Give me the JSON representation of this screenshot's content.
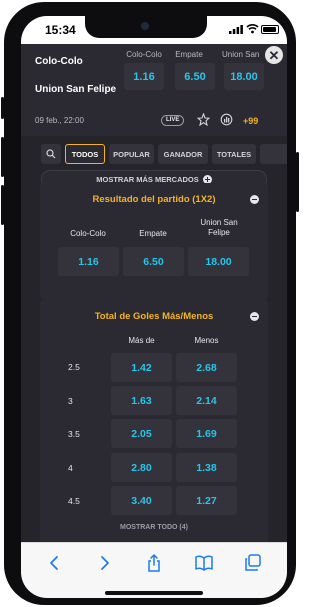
{
  "status": {
    "time": "15:34"
  },
  "match": {
    "home": "Colo-Colo",
    "away": "Union San Felipe",
    "date": "09 feb., 22:00",
    "live_label": "LIVE",
    "more_markets_count": "+99",
    "odds": [
      {
        "label": "Colo-Colo",
        "value": "1.16"
      },
      {
        "label": "Empate",
        "value": "6.50"
      },
      {
        "label": "Union San Felipe",
        "value": "18.00"
      }
    ],
    "close_symbol": "✕"
  },
  "filters": {
    "chips": [
      "TODOS",
      "POPULAR",
      "GANADOR",
      "TOTALES"
    ],
    "active": "TODOS"
  },
  "show_more_markets": "MOSTRAR MÁS MERCADOS",
  "result_market": {
    "title": "Resultado del partido (1X2)",
    "columns": [
      "Colo-Colo",
      "Empate",
      "Union San Felipe"
    ],
    "odds": [
      "1.16",
      "6.50",
      "18.00"
    ]
  },
  "goals_market": {
    "title": "Total de Goles Más/Menos",
    "col_over": "Más de",
    "col_under": "Menos",
    "rows": [
      {
        "line": "2.5",
        "over": "1.42",
        "under": "2.68"
      },
      {
        "line": "3",
        "over": "1.63",
        "under": "2.14"
      },
      {
        "line": "3.5",
        "over": "2.05",
        "under": "1.69"
      },
      {
        "line": "4",
        "over": "2.80",
        "under": "1.38"
      },
      {
        "line": "4.5",
        "over": "3.40",
        "under": "1.27"
      }
    ],
    "show_all": "MOSTRAR TODO (4)"
  },
  "icons": {
    "search": "search-icon",
    "star": "star-icon",
    "stats": "stats-icon",
    "back": "chevron-left-icon",
    "forward": "chevron-right-icon",
    "share": "share-icon",
    "bookmarks": "book-icon",
    "tabs": "tabs-icon"
  },
  "colors": {
    "background": "#25242b",
    "card": "#2b2a32",
    "accent": "#f5b324",
    "odds": "#27c5ea"
  }
}
